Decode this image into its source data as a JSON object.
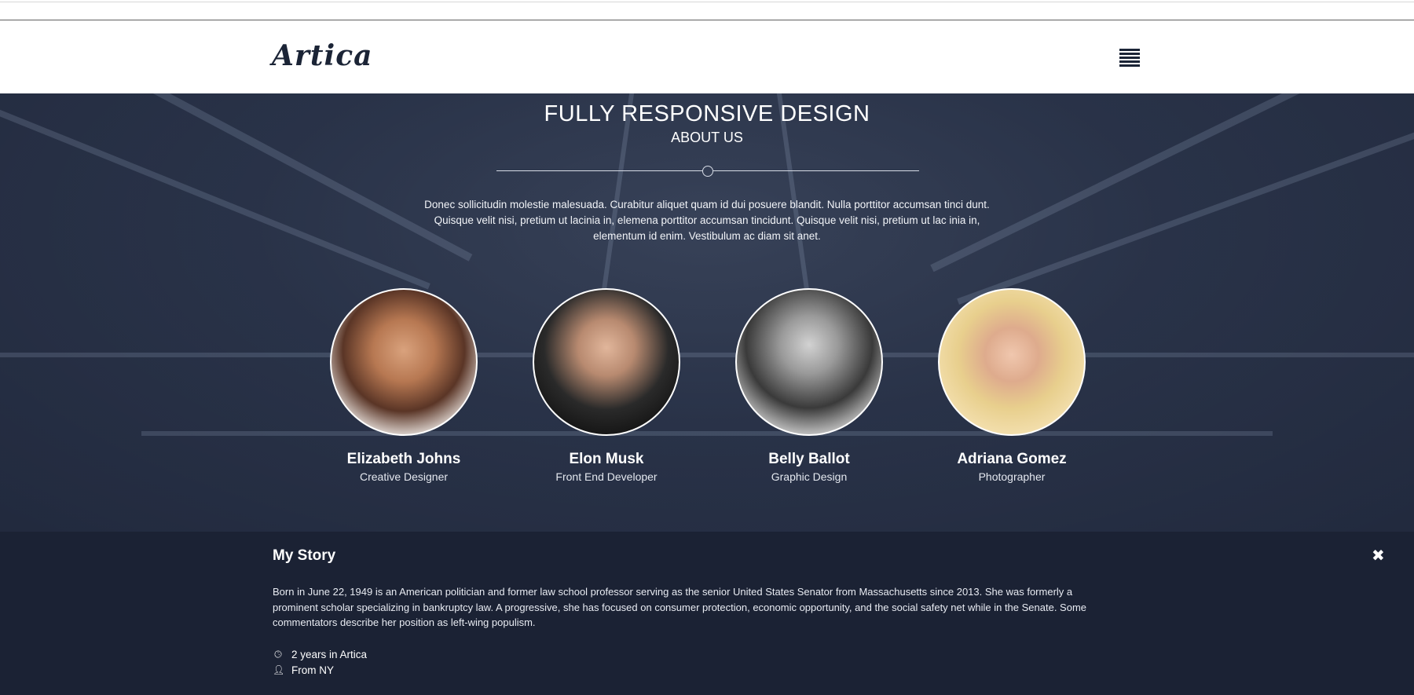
{
  "navbar": {
    "logo_text": "Artica",
    "menu_icon": "hamburger-menu-icon"
  },
  "hero": {
    "title": "FULLY RESPONSIVE DESIGN",
    "subtitle": "ABOUT US",
    "intro_line1": "Donec sollicitudin molestie malesuada. Curabitur aliquet quam id dui posuere blandit. Nulla porttitor accumsan tinci dunt.",
    "intro_line2": "Quisque velit nisi, pretium ut lacinia in, elemena porttitor accumsan tincidunt. Quisque velit nisi, pretium ut lac inia in,",
    "intro_line3": "elementum id enim. Vestibulum ac diam sit anet."
  },
  "team": [
    {
      "name": "Elizabeth Johns",
      "role": "Creative Designer"
    },
    {
      "name": "Elon Musk",
      "role": "Front End Developer"
    },
    {
      "name": "Belly Ballot",
      "role": "Graphic Design"
    },
    {
      "name": "Adriana Gomez",
      "role": "Photographer"
    }
  ],
  "story": {
    "title": "My Story",
    "close_icon": "close-icon",
    "text_line1": "Born in June 22, 1949 is an American politician and former law school professor serving as the senior United States Senator from Massachusetts since 2013. She was formerly a",
    "text_line2": "prominent scholar specializing in bankruptcy law. A progressive, she has focused on consumer protection, economic opportunity, and the social safety net while in the Senate. Some",
    "text_line3": "commentators describe her position as left-wing populism.",
    "meta_tenure": "2 years in Artica",
    "meta_origin": "From NY"
  }
}
